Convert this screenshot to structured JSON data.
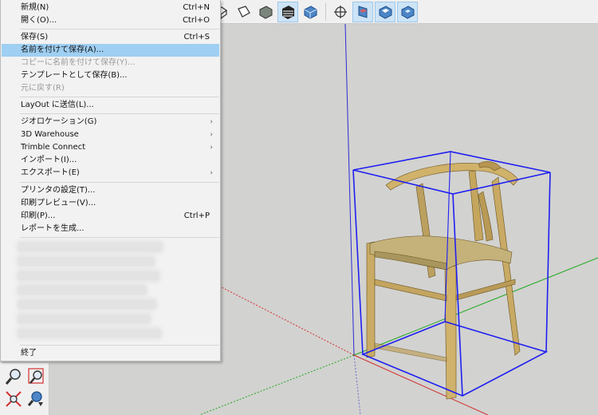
{
  "menu": {
    "group1": [
      {
        "label": "新規(N)",
        "shortcut": "Ctrl+N",
        "state": "normal"
      },
      {
        "label": "開く(O)...",
        "shortcut": "Ctrl+O",
        "state": "normal"
      }
    ],
    "group2": [
      {
        "label": "保存(S)",
        "shortcut": "Ctrl+S",
        "state": "normal"
      },
      {
        "label": "名前を付けて保存(A)...",
        "shortcut": "",
        "state": "highlighted"
      },
      {
        "label": "コピーに名前を付けて保存(Y)...",
        "shortcut": "",
        "state": "disabled"
      },
      {
        "label": "テンプレートとして保存(B)...",
        "shortcut": "",
        "state": "normal"
      },
      {
        "label": "元に戻す(R)",
        "shortcut": "",
        "state": "disabled"
      }
    ],
    "group3": [
      {
        "label": "LayOut に送信(L)..."
      }
    ],
    "group4": [
      {
        "label": "ジオロケーション(G)",
        "submenu": true
      },
      {
        "label": "3D Warehouse",
        "submenu": true
      },
      {
        "label": "Trimble Connect",
        "submenu": true
      },
      {
        "label": "インポート(I)...",
        "submenu": false
      },
      {
        "label": "エクスポート(E)",
        "submenu": true
      }
    ],
    "group5": [
      {
        "label": "プリンタの設定(T)...",
        "shortcut": ""
      },
      {
        "label": "印刷プレビュー(V)...",
        "shortcut": ""
      },
      {
        "label": "印刷(P)...",
        "shortcut": "Ctrl+P"
      },
      {
        "label": "レポートを生成...",
        "shortcut": ""
      }
    ],
    "recent_files_blurred_count": 8,
    "exit": "終了"
  },
  "toolbar": {
    "icons": [
      "box-view-icon",
      "flat-face-view-icon",
      "shaded-view-icon",
      "shaded-textures-view-icon",
      "monochrome-view-icon",
      "axes-toggle-icon",
      "section-plane-icon",
      "section-cut-icon",
      "section-fill-icon"
    ],
    "active": [
      "shaded-textures-view-icon",
      "section-cut-icon",
      "section-fill-icon"
    ]
  },
  "left_tools": [
    "zoom-icon",
    "zoom-window-icon",
    "zoom-extents-icon",
    "previous-view-icon"
  ],
  "colors": {
    "highlight": "#9fcff2",
    "selection_box": "#1f1ff2",
    "axis_red": "#d23030",
    "axis_green": "#1fa81f",
    "axis_blue": "#2020d0"
  }
}
